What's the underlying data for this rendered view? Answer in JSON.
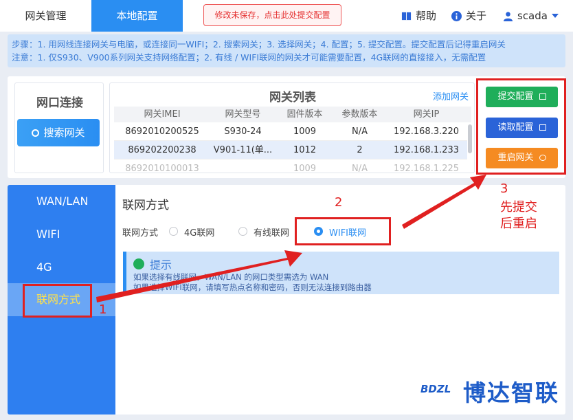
{
  "topbar": {
    "tab_gateway": "网关管理",
    "tab_local": "本地配置",
    "unsaved_notice": "修改未保存，点击此处提交配置",
    "help": "帮助",
    "about": "关于",
    "user": "scada"
  },
  "steps": {
    "line1": "步骤：1. 用网线连接网关与电脑，或连接同一WIFI；2. 搜索网关；3. 选择网关；4. 配置；5. 提交配置。提交配置后记得重启网关",
    "line2": "注意：1. 仅S930、V900系列网关支持网络配置；2. 有线 / WIFI联网的网关才可能需要配置，4G联网的直接接入，无需配置"
  },
  "port": {
    "title": "网口连接",
    "search_button": "搜索网关"
  },
  "gateway_list": {
    "title": "网关列表",
    "add_link": "添加网关",
    "columns": [
      "网关IMEI",
      "网关型号",
      "固件版本",
      "参数版本",
      "网关IP"
    ],
    "rows": [
      [
        "8692010200525",
        "S930-24",
        "1009",
        "N/A",
        "192.168.3.220"
      ],
      [
        "869202200238",
        "V901-11(单...",
        "1012",
        "2",
        "192.168.1.233"
      ],
      [
        "8692010100013",
        "",
        "1009",
        "N/A",
        "192.168.1.225"
      ]
    ]
  },
  "actions": {
    "submit": "提交配置",
    "read": "读取配置",
    "restart": "重启网关"
  },
  "sidebar": {
    "items": [
      {
        "label": "WAN/LAN"
      },
      {
        "label": "WIFI"
      },
      {
        "label": "4G"
      },
      {
        "label": "联网方式"
      }
    ]
  },
  "network": {
    "section_title": "联网方式",
    "field_label": "联网方式",
    "options": [
      "4G联网",
      "有线联网",
      "WIFI联网"
    ],
    "selected": "WIFI联网"
  },
  "tip": {
    "title": "提示",
    "line1": "如果选择有线联网，WAN/LAN 的网口类型需选为 WAN",
    "line2": "如果选择WIFI联网，请填写热点名称和密码，否则无法连接到路由器"
  },
  "annotations": {
    "n1": "1",
    "n2": "2",
    "n3": "3",
    "n3_text": "先提交后重启"
  },
  "logo": {
    "badge": "BDZL",
    "name": "博达智联"
  },
  "colors": {
    "primary": "#2a8ef2",
    "submit": "#1fae5a",
    "read": "#2a63d8",
    "restart": "#f58b22",
    "annotation": "#e02020"
  }
}
